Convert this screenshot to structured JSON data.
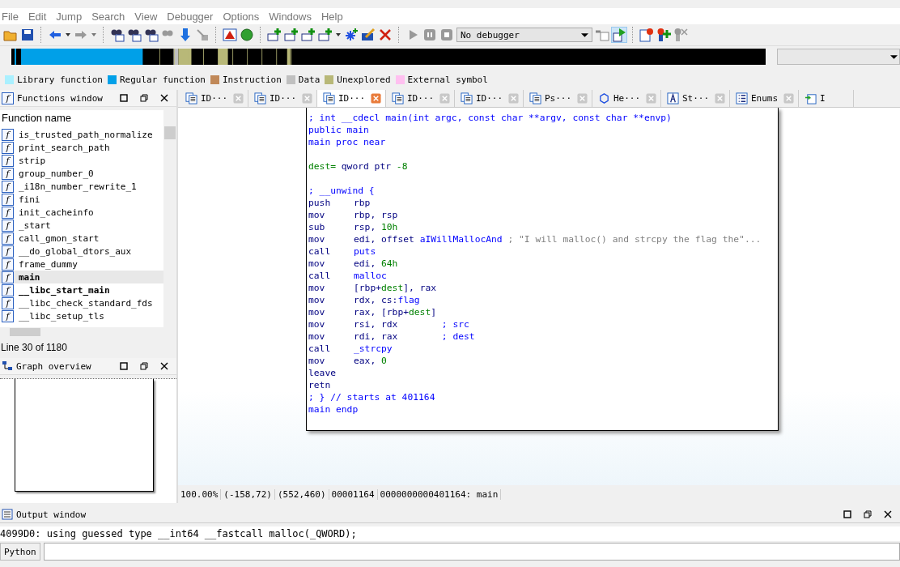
{
  "menu": [
    "File",
    "Edit",
    "Jump",
    "Search",
    "View",
    "Debugger",
    "Options",
    "Windows",
    "Help"
  ],
  "toolbar": {
    "debugger_select": "No debugger"
  },
  "legend": [
    {
      "label": "Library function",
      "color": "#aaf0ff"
    },
    {
      "label": "Regular function",
      "color": "#00a0e8"
    },
    {
      "label": "Instruction",
      "color": "#c08858"
    },
    {
      "label": "Data",
      "color": "#c0c0c0"
    },
    {
      "label": "Unexplored",
      "color": "#b8b878"
    },
    {
      "label": "External symbol",
      "color": "#ffc0f0"
    }
  ],
  "functions_window": {
    "title_icon": "f",
    "title": "Functions window",
    "column": "Function name",
    "rows": [
      {
        "icon": "f",
        "name": "is_trusted_path_normalize",
        "bold": false,
        "selected": false
      },
      {
        "icon": "f",
        "name": "print_search_path",
        "bold": false,
        "selected": false
      },
      {
        "icon": "f",
        "name": "strip",
        "bold": false,
        "selected": false
      },
      {
        "icon": "f",
        "name": "group_number_0",
        "bold": false,
        "selected": false
      },
      {
        "icon": "f",
        "name": "_i18n_number_rewrite_1",
        "bold": false,
        "selected": false
      },
      {
        "icon": "f",
        "name": "fini",
        "bold": false,
        "selected": false
      },
      {
        "icon": "f",
        "name": "init_cacheinfo",
        "bold": false,
        "selected": false
      },
      {
        "icon": "f",
        "name": "_start",
        "bold": false,
        "selected": false
      },
      {
        "icon": "f",
        "name": "call_gmon_start",
        "bold": false,
        "selected": false
      },
      {
        "icon": "f",
        "name": "__do_global_dtors_aux",
        "bold": false,
        "selected": false
      },
      {
        "icon": "f",
        "name": "frame_dummy",
        "bold": false,
        "selected": false
      },
      {
        "icon": "f",
        "name": "main",
        "bold": true,
        "selected": true
      },
      {
        "icon": "f",
        "name": "__libc_start_main",
        "bold": true,
        "selected": false
      },
      {
        "icon": "f",
        "name": "__libc_check_standard_fds",
        "bold": false,
        "selected": false
      },
      {
        "icon": "f",
        "name": "__libc_setup_tls",
        "bold": false,
        "selected": false
      }
    ],
    "status": "Line 30 of 1180"
  },
  "graph_overview": {
    "title": "Graph overview"
  },
  "tabs": [
    {
      "label": "ID···",
      "kind": "view",
      "selected": false
    },
    {
      "label": "ID···",
      "kind": "view",
      "selected": false
    },
    {
      "label": "ID···",
      "kind": "view",
      "selected": true
    },
    {
      "label": "ID···",
      "kind": "view",
      "selected": false
    },
    {
      "label": "ID···",
      "kind": "view",
      "selected": false
    },
    {
      "label": "Ps···",
      "kind": "view",
      "selected": false
    },
    {
      "label": "He···",
      "kind": "hex",
      "selected": false
    },
    {
      "label": "St···",
      "kind": "strings",
      "selected": false
    },
    {
      "label": "Enums",
      "kind": "enums",
      "selected": false
    },
    {
      "label": "I",
      "kind": "imports",
      "selected": false
    }
  ],
  "disassembly": [
    {
      "segments": [
        {
          "text": "; int __cdecl main(int argc, const char **argv, const char **envp)",
          "kind": "name"
        }
      ]
    },
    {
      "segments": [
        {
          "text": "public main",
          "kind": "name"
        }
      ]
    },
    {
      "segments": [
        {
          "text": "main proc near",
          "kind": "name"
        }
      ]
    },
    {
      "kind": "blank"
    },
    {
      "segments": [
        {
          "text": "dest=",
          "kind": "num"
        },
        {
          "text": " qword ptr ",
          "kind": "plain"
        },
        {
          "text": "-8",
          "kind": "num"
        }
      ]
    },
    {
      "kind": "blank"
    },
    {
      "segments": [
        {
          "text": "; __unwind {",
          "kind": "name"
        }
      ]
    },
    {
      "mnemonic": "push",
      "segments": [
        {
          "text": "rbp",
          "kind": "plain"
        }
      ]
    },
    {
      "mnemonic": "mov",
      "segments": [
        {
          "text": "rbp, rsp",
          "kind": "plain"
        }
      ]
    },
    {
      "mnemonic": "sub",
      "segments": [
        {
          "text": "rsp, ",
          "kind": "plain"
        },
        {
          "text": "10h",
          "kind": "num"
        }
      ]
    },
    {
      "mnemonic": "mov",
      "segments": [
        {
          "text": "edi, offset ",
          "kind": "plain"
        },
        {
          "text": "aIWillMallocAnd",
          "kind": "name"
        },
        {
          "text": " ; \"I will malloc() and strcpy the flag the\"...",
          "kind": "comment"
        }
      ]
    },
    {
      "mnemonic": "call",
      "segments": [
        {
          "text": "puts",
          "kind": "name"
        }
      ]
    },
    {
      "mnemonic": "mov",
      "segments": [
        {
          "text": "edi, ",
          "kind": "plain"
        },
        {
          "text": "64h",
          "kind": "num"
        }
      ]
    },
    {
      "mnemonic": "call",
      "segments": [
        {
          "text": "malloc",
          "kind": "name"
        }
      ]
    },
    {
      "mnemonic": "mov",
      "segments": [
        {
          "text": "[rbp+",
          "kind": "plain"
        },
        {
          "text": "dest",
          "kind": "num"
        },
        {
          "text": "], rax",
          "kind": "plain"
        }
      ]
    },
    {
      "mnemonic": "mov",
      "segments": [
        {
          "text": "rdx, cs:",
          "kind": "plain"
        },
        {
          "text": "flag",
          "kind": "name"
        }
      ]
    },
    {
      "mnemonic": "mov",
      "segments": [
        {
          "text": "rax, [rbp+",
          "kind": "plain"
        },
        {
          "text": "dest",
          "kind": "num"
        },
        {
          "text": "]",
          "kind": "plain"
        }
      ]
    },
    {
      "mnemonic": "mov",
      "segments": [
        {
          "text": "rsi, rdx        ",
          "kind": "plain"
        },
        {
          "text": "; src",
          "kind": "name"
        }
      ]
    },
    {
      "mnemonic": "mov",
      "segments": [
        {
          "text": "rdi, rax        ",
          "kind": "plain"
        },
        {
          "text": "; dest",
          "kind": "name"
        }
      ]
    },
    {
      "mnemonic": "call",
      "segments": [
        {
          "text": "_strcpy",
          "kind": "name"
        }
      ]
    },
    {
      "mnemonic": "mov",
      "segments": [
        {
          "text": "eax, ",
          "kind": "plain"
        },
        {
          "text": "0",
          "kind": "num"
        }
      ]
    },
    {
      "mnemonic": "leave"
    },
    {
      "mnemonic": "retn"
    },
    {
      "segments": [
        {
          "text": "; } // starts at 401164",
          "kind": "name"
        }
      ]
    },
    {
      "segments": [
        {
          "text": "main endp",
          "kind": "name"
        }
      ]
    }
  ],
  "graph_status": [
    "100.00%",
    "(-158,72)",
    "(552,460)",
    "00001164",
    "0000000000401164: main"
  ],
  "output_window": {
    "title": "Output window",
    "line": "4099D0: using guessed type __int64 __fastcall malloc(_QWORD);",
    "console_button": "Python"
  }
}
